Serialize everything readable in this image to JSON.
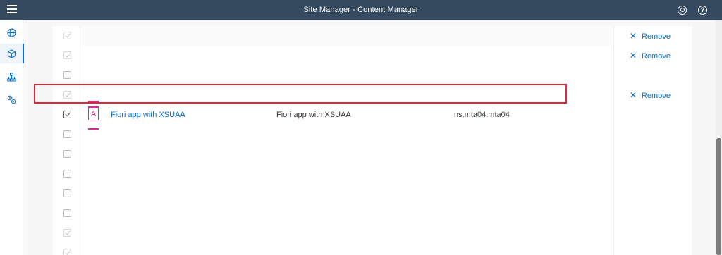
{
  "shell": {
    "title": "Site Manager - Content Manager",
    "help_glyph": "?"
  },
  "sidenav": {
    "items": [
      {
        "icon": "globe-icon"
      },
      {
        "icon": "cube-icon",
        "active": true
      },
      {
        "icon": "hierarchy-icon"
      },
      {
        "icon": "gears-icon"
      }
    ]
  },
  "table": {
    "rows": [
      {
        "checked": "light",
        "action": "Remove"
      },
      {
        "checked": "light",
        "action": "Remove"
      },
      {
        "checked": "none",
        "action": ""
      },
      {
        "checked": "light",
        "action": "Remove"
      },
      {
        "checked": "dark",
        "title": "Fiori app with XSUAA",
        "tile_letter": "A",
        "description": "Fiori app with XSUAA",
        "id": "ns.mta04.mta04",
        "action": ""
      },
      {
        "checked": "none",
        "action": ""
      },
      {
        "checked": "none",
        "action": ""
      },
      {
        "checked": "none",
        "action": ""
      },
      {
        "checked": "none",
        "action": ""
      },
      {
        "checked": "none",
        "action": ""
      },
      {
        "checked": "light",
        "action": ""
      }
    ]
  },
  "colors": {
    "shellbar": "#354a5f",
    "link": "#0a6ed1",
    "tile_accent": "#cf2f95",
    "highlight": "#e0263a"
  }
}
